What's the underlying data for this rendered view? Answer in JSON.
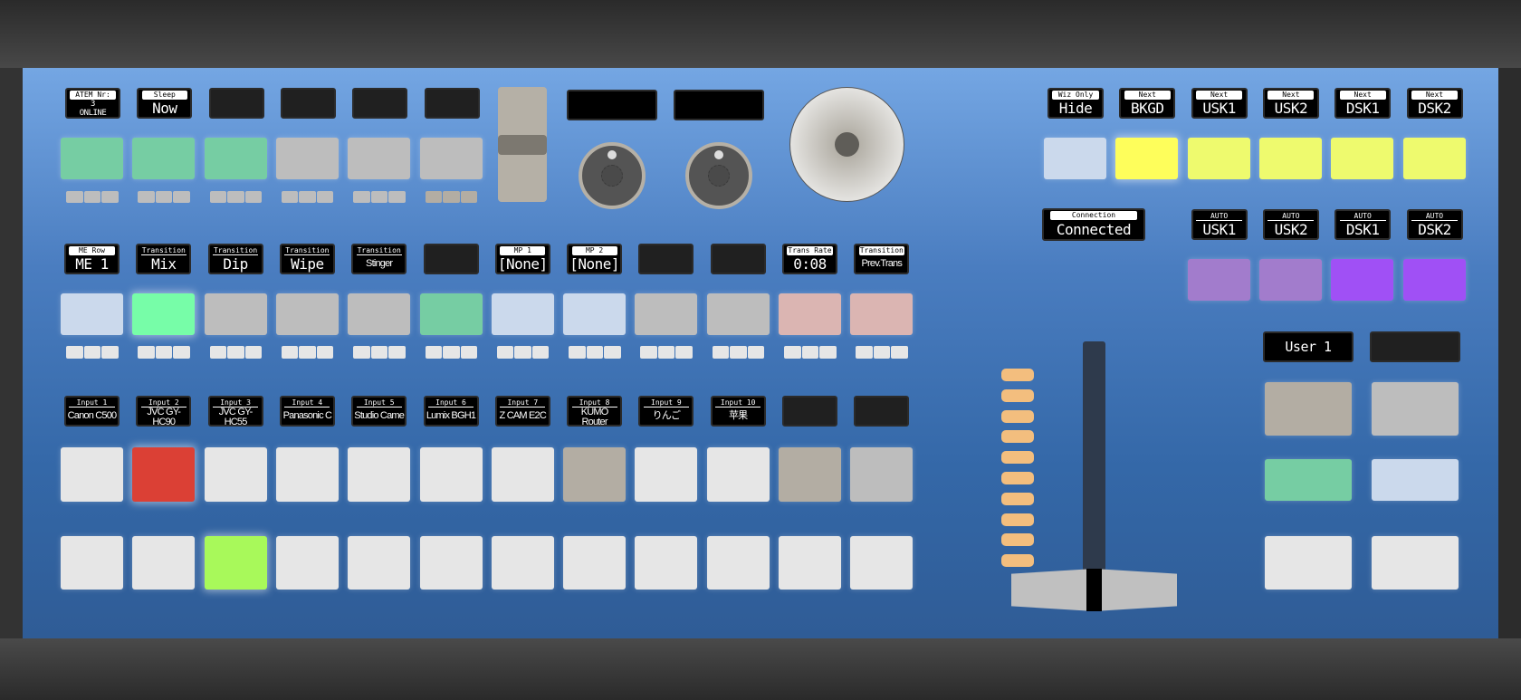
{
  "colors": {
    "green": "#76cda3",
    "bright_green": "#77fda8",
    "gray": "#bdbdbd",
    "light_blue": "#cbd9ec",
    "pink": "#dbb5b2",
    "red": "#db4035",
    "lime": "#a8f95a",
    "tan": "#b3ada3",
    "white": "#e6e6e6",
    "yellow": "#fefe5b",
    "pale_yellow": "#eefa6e",
    "lavender": "#a27ccc",
    "purple": "#a050f5",
    "led_orange": "#f3be7e"
  },
  "left": {
    "row1": {
      "displays": [
        {
          "title": "ATEM Nr:",
          "value": "3\nONLINE",
          "highlight": true
        },
        {
          "title": "Sleep",
          "value": "Now",
          "highlight": true
        },
        null,
        null,
        null,
        null
      ],
      "buttons": [
        "green",
        "green",
        "green",
        "gray",
        "gray",
        "gray"
      ],
      "strips": [
        "gray",
        "gray",
        "gray",
        "gray",
        "gray",
        "tan"
      ]
    },
    "row2": {
      "displays": [
        {
          "title": "ME Row",
          "value": "ME 1",
          "highlight": true
        },
        {
          "title": "Transition",
          "value": "Mix",
          "highlight": false
        },
        {
          "title": "Transition",
          "value": "Dip",
          "highlight": false
        },
        {
          "title": "Transition",
          "value": "Wipe",
          "highlight": false
        },
        {
          "title": "Transition",
          "value": "Stinger",
          "highlight": false
        },
        null,
        {
          "title": "MP 1",
          "value": "[None]",
          "highlight": true
        },
        {
          "title": "MP 2",
          "value": "[None]",
          "highlight": true
        },
        null,
        null,
        {
          "title": "Trans Rate",
          "value": "0:08",
          "highlight": true
        },
        {
          "title": "Transition",
          "value": "Prev.Trans",
          "highlight": true
        }
      ],
      "buttons": [
        "light_blue",
        "bright_green",
        "gray",
        "gray",
        "gray",
        "green",
        "light_blue",
        "light_blue",
        "gray",
        "gray",
        "pink",
        "pink"
      ],
      "strips": [
        "white",
        "white",
        "white",
        "white",
        "white",
        "white",
        "white",
        "white",
        "white",
        "white",
        "white",
        "white"
      ]
    },
    "row3": {
      "displays": [
        {
          "title": "Input 1",
          "value": "Canon C500",
          "highlight": false
        },
        {
          "title": "Input 2",
          "value": "JVC GY-HC90",
          "highlight": false
        },
        {
          "title": "Input 3",
          "value": "JVC GY-HC55",
          "highlight": false
        },
        {
          "title": "Input 4",
          "value": "Panasonic C",
          "highlight": false
        },
        {
          "title": "Input 5",
          "value": "Studio Came",
          "highlight": false
        },
        {
          "title": "Input 6",
          "value": "Lumix BGH1",
          "highlight": false
        },
        {
          "title": "Input 7",
          "value": "Z CAM E2C",
          "highlight": false
        },
        {
          "title": "Input 8",
          "value": "KUMO Router",
          "highlight": false
        },
        {
          "title": "Input 9",
          "value": "りんご",
          "highlight": false
        },
        {
          "title": "Input 10",
          "value": "苹果",
          "highlight": false
        },
        null,
        null
      ],
      "buttons": [
        "white",
        "red",
        "white",
        "white",
        "white",
        "white",
        "white",
        "tan",
        "white",
        "white",
        "tan",
        "gray"
      ]
    },
    "row4": {
      "buttons": [
        "white",
        "white",
        "lime",
        "white",
        "white",
        "white",
        "white",
        "white",
        "white",
        "white",
        "white",
        "white"
      ]
    }
  },
  "center": {
    "displays": [
      "",
      ""
    ],
    "fader_label": "",
    "knobs": [
      "knob-1",
      "knob-2"
    ],
    "jog_wheel": "jog-wheel"
  },
  "right": {
    "next_displays": [
      {
        "title": "Wiz Only",
        "value": "Hide"
      },
      {
        "title": "Next",
        "value": "BKGD"
      },
      {
        "title": "Next",
        "value": "USK1"
      },
      {
        "title": "Next",
        "value": "USK2"
      },
      {
        "title": "Next",
        "value": "DSK1"
      },
      {
        "title": "Next",
        "value": "DSK2"
      }
    ],
    "next_buttons": [
      "light_blue",
      "yellow",
      "pale_yellow",
      "pale_yellow",
      "pale_yellow",
      "pale_yellow"
    ],
    "connection": {
      "title": "Connection",
      "value": "Connected"
    },
    "auto_displays": [
      {
        "title": "AUTO",
        "value": "USK1"
      },
      {
        "title": "AUTO",
        "value": "USK2"
      },
      {
        "title": "AUTO",
        "value": "DSK1"
      },
      {
        "title": "AUTO",
        "value": "DSK2"
      }
    ],
    "auto_buttons": [
      "lavender",
      "lavender",
      "purple",
      "purple"
    ],
    "tbar": {
      "led_count": 10,
      "position": 0
    },
    "user_displays": [
      "User 1",
      ""
    ],
    "user_buttons": [
      [
        "tan",
        "gray"
      ],
      [
        "green",
        "light_blue"
      ],
      [
        "white",
        "white"
      ]
    ]
  }
}
